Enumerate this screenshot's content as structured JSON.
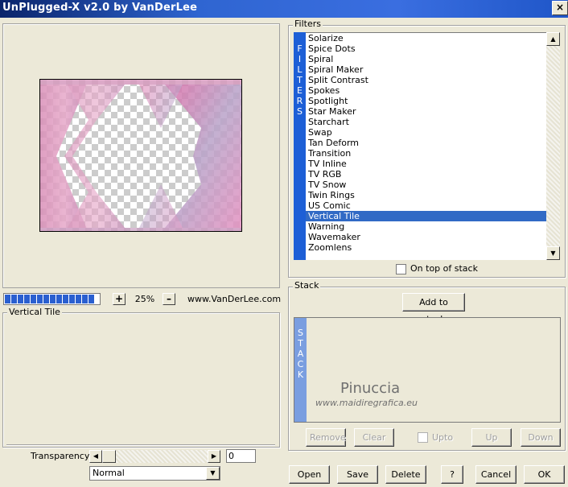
{
  "window": {
    "title": "UnPlugged-X v2.0 by VanDerLee",
    "close_glyph": "×"
  },
  "preview": {
    "zoom_minus": "–",
    "zoom_plus": "+",
    "zoom_value": "25%",
    "url": "www.VanDerLee.com",
    "progress_segments": 14
  },
  "filters": {
    "label": "Filters",
    "side_letters": [
      "F",
      "I",
      "L",
      "T",
      "E",
      "R",
      "S"
    ],
    "items": [
      "Solarize",
      "Spice Dots",
      "Spiral",
      "Spiral Maker",
      "Split Contrast",
      "Spokes",
      "Spotlight",
      "Star Maker",
      "Starchart",
      "Swap",
      "Tan Deform",
      "Transition",
      "TV Inline",
      "TV RGB",
      "TV Snow",
      "Twin Rings",
      "US Comic",
      "Vertical Tile",
      "Warning",
      "Wavemaker",
      "Zoomlens"
    ],
    "selected": "Vertical Tile",
    "on_top_label": "On top of stack"
  },
  "stack": {
    "label": "Stack",
    "add_button": "Add to stack",
    "side_letters": [
      "S",
      "T",
      "A",
      "C",
      "K"
    ],
    "watermark_title": "Pinuccia",
    "watermark_url": "www.maidiregrafica.eu",
    "remove_button": "Remove",
    "clear_button": "Clear",
    "upto_label": "Upto",
    "up_button": "Up",
    "down_button": "Down"
  },
  "params": {
    "group_label": "Vertical Tile",
    "transparency_label": "Transparency",
    "transparency_value": "0",
    "blend_mode": "Normal"
  },
  "footer": {
    "open": "Open",
    "save": "Save",
    "delete": "Delete",
    "help": "?",
    "cancel": "Cancel",
    "ok": "OK"
  }
}
